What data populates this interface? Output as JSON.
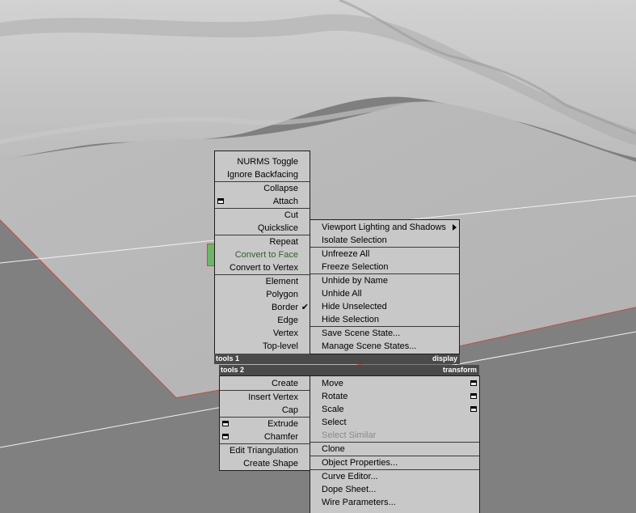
{
  "menu_left_top": {
    "items": [
      {
        "label": "NURMS Toggle"
      },
      {
        "label": "Ignore Backfacing"
      },
      {
        "sep": true
      },
      {
        "label": "Collapse"
      },
      {
        "label": "Attach",
        "icon": "settings-box-icon"
      },
      {
        "sep": true
      },
      {
        "label": "Cut"
      },
      {
        "label": "Quickslice"
      },
      {
        "sep": true
      },
      {
        "label": "Repeat"
      },
      {
        "label": "Convert to Face",
        "highlight": true
      },
      {
        "label": "Convert to Vertex"
      },
      {
        "sep": true
      },
      {
        "label": "Element"
      },
      {
        "label": "Polygon"
      },
      {
        "label": "Border",
        "checked": true
      },
      {
        "label": "Edge"
      },
      {
        "label": "Vertex"
      },
      {
        "label": "Top-level"
      }
    ]
  },
  "header1": {
    "left": "tools 1",
    "right": "display"
  },
  "header2": {
    "left": "tools 2",
    "right": "transform"
  },
  "menu_display": {
    "items": [
      {
        "label": "Viewport Lighting and Shadows",
        "submenu": true
      },
      {
        "label": "Isolate Selection"
      },
      {
        "sep": true
      },
      {
        "label": "Unfreeze All"
      },
      {
        "label": "Freeze Selection"
      },
      {
        "sep": true
      },
      {
        "label": "Unhide by Name"
      },
      {
        "label": "Unhide All"
      },
      {
        "label": "Hide Unselected"
      },
      {
        "label": "Hide Selection"
      },
      {
        "sep": true
      },
      {
        "label": "Save Scene State..."
      },
      {
        "label": "Manage Scene States..."
      }
    ]
  },
  "menu_tools2": {
    "items": [
      {
        "label": "Create"
      },
      {
        "sep": true
      },
      {
        "label": "Insert Vertex"
      },
      {
        "label": "Cap"
      },
      {
        "sep": true
      },
      {
        "label": "Extrude",
        "icon": "settings-box-icon"
      },
      {
        "label": "Chamfer",
        "icon": "settings-box-icon"
      },
      {
        "sep": true
      },
      {
        "label": "Edit Triangulation"
      },
      {
        "label": "Create Shape"
      }
    ]
  },
  "menu_transform": {
    "items": [
      {
        "label": "Move",
        "icon": "settings-box-icon"
      },
      {
        "label": "Rotate",
        "icon": "settings-box-icon"
      },
      {
        "label": "Scale",
        "icon": "settings-box-icon"
      },
      {
        "label": "Select"
      },
      {
        "label": "Select Similar",
        "disabled": true
      },
      {
        "sep": true
      },
      {
        "label": "Clone"
      },
      {
        "sep": true
      },
      {
        "label": "Object Properties..."
      },
      {
        "sep": true
      },
      {
        "label": "Curve Editor..."
      },
      {
        "label": "Dope Sheet..."
      },
      {
        "label": "Wire Parameters..."
      }
    ]
  }
}
